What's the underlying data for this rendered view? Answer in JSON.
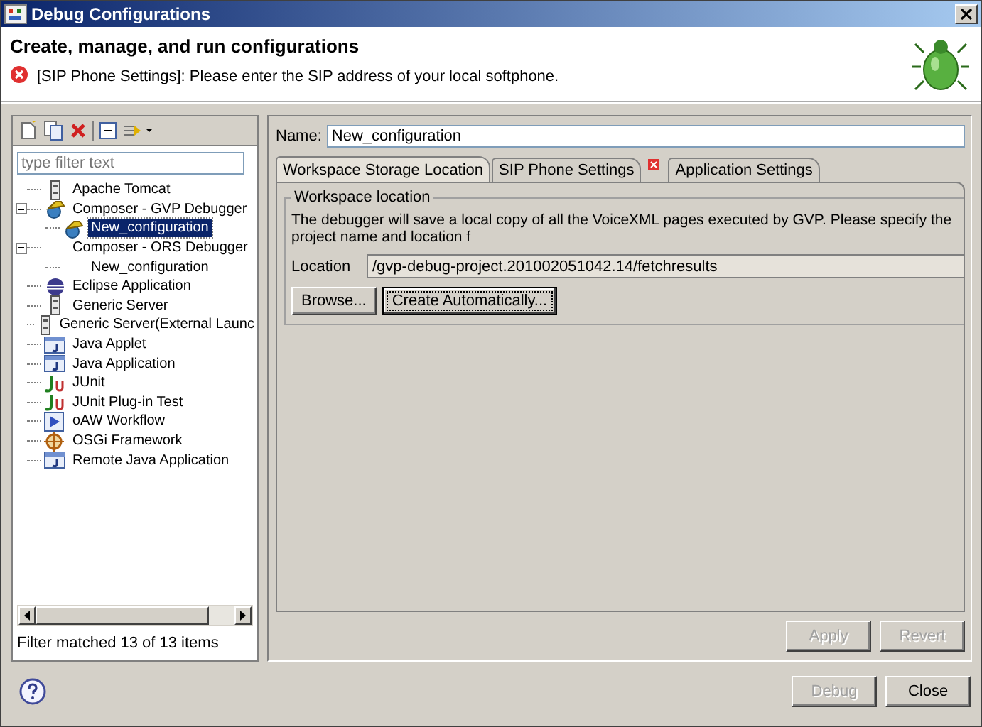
{
  "window": {
    "title": "Debug Configurations"
  },
  "header": {
    "title": "Create, manage, and run configurations",
    "message": "[SIP Phone Settings]: Please enter the SIP address of your local softphone."
  },
  "filter": {
    "placeholder": "type filter text"
  },
  "tree": [
    {
      "label": "Apache Tomcat",
      "kind": "server",
      "selected": false
    },
    {
      "label": "Composer - GVP Debugger",
      "kind": "launcher",
      "expanded": true,
      "selected": false,
      "children": [
        {
          "label": "New_configuration",
          "kind": "launcher",
          "selected": true
        }
      ]
    },
    {
      "label": "Composer - ORS Debugger",
      "kind": "none",
      "expanded": true,
      "selected": false,
      "children": [
        {
          "label": "New_configuration",
          "kind": "none",
          "selected": false
        }
      ]
    },
    {
      "label": "Eclipse Application",
      "kind": "eclipse",
      "selected": false
    },
    {
      "label": "Generic Server",
      "kind": "server",
      "selected": false
    },
    {
      "label": "Generic Server(External Launc",
      "kind": "server",
      "selected": false
    },
    {
      "label": "Java Applet",
      "kind": "applet",
      "selected": false
    },
    {
      "label": "Java Application",
      "kind": "app",
      "selected": false
    },
    {
      "label": "JUnit",
      "kind": "junit",
      "selected": false
    },
    {
      "label": "JUnit Plug-in Test",
      "kind": "junit",
      "selected": false
    },
    {
      "label": "oAW Workflow",
      "kind": "workflow",
      "selected": false
    },
    {
      "label": "OSGi Framework",
      "kind": "osgi",
      "selected": false
    },
    {
      "label": "Remote Java Application",
      "kind": "app",
      "selected": false
    }
  ],
  "filter_status": "Filter matched 13 of 13 items",
  "name_field": {
    "label": "Name:",
    "value": "New_configuration"
  },
  "tabs": [
    {
      "label": "Workspace Storage Location",
      "selected": true,
      "error": false
    },
    {
      "label": "SIP Phone Settings",
      "selected": false,
      "error": true
    },
    {
      "label": "Application Settings",
      "selected": false,
      "error": false
    }
  ],
  "group": {
    "title": "Workspace location",
    "description": "The debugger will save a local copy of all the VoiceXML pages executed by GVP. Please specify the project name and location f",
    "location_label": "Location",
    "location_value": "/gvp-debug-project.201002051042.14/fetchresults",
    "buttons": [
      {
        "label": "Browse...",
        "focused": false
      },
      {
        "label": "Create Automatically...",
        "focused": true
      }
    ]
  },
  "panel_buttons": [
    {
      "label": "Apply",
      "disabled": true
    },
    {
      "label": "Revert",
      "disabled": true
    }
  ],
  "dialog_buttons": [
    {
      "label": "Debug",
      "disabled": true
    },
    {
      "label": "Close",
      "disabled": false
    }
  ]
}
